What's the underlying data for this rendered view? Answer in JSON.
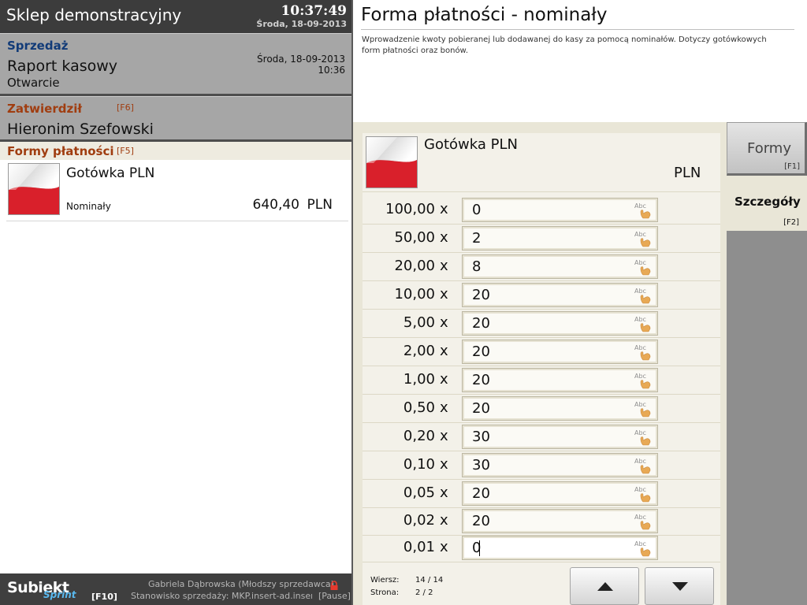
{
  "header": {
    "store_name": "Sklep demonstracyjny",
    "time": "10:37:49",
    "date": "Środa, 18-09-2013"
  },
  "sale": {
    "title": "Sprzedaż",
    "document": "Raport kasowy",
    "status": "Otwarcie",
    "date": "Środa, 18-09-2013",
    "time": "10:36"
  },
  "confirmed": {
    "title": "Zatwierdził",
    "key": "[F6]",
    "name": "Hieronim Szefowski"
  },
  "payment_forms": {
    "title": "Formy płatności",
    "key": "[F5]",
    "items": [
      {
        "name": "Gotówka PLN",
        "type": "Nominały",
        "amount": "640,40",
        "currency": "PLN"
      }
    ]
  },
  "footer": {
    "logo": "Subiekt",
    "logo_sub": "Sprint",
    "key": "[F10]",
    "user": "Gabriela Dąbrowska (Młodszy sprzedawca)",
    "station": "Stanowisko sprzedaży: MKP.insert-ad.insert....",
    "pause": "[Pause]"
  },
  "main": {
    "title": "Forma płatności - nominały",
    "description": "Wprowadzenie kwoty pobieranej lub dodawanej do kasy za pomocą nominałów. Dotyczy gotówkowych form płatności oraz bonów.",
    "card_name": "Gotówka PLN",
    "card_currency": "PLN",
    "multiply_sign": "x",
    "denominations": [
      {
        "value": "100,00",
        "count": "0"
      },
      {
        "value": "50,00",
        "count": "2"
      },
      {
        "value": "20,00",
        "count": "8"
      },
      {
        "value": "10,00",
        "count": "20"
      },
      {
        "value": "5,00",
        "count": "20"
      },
      {
        "value": "2,00",
        "count": "20"
      },
      {
        "value": "1,00",
        "count": "20"
      },
      {
        "value": "0,50",
        "count": "20"
      },
      {
        "value": "0,20",
        "count": "30"
      },
      {
        "value": "0,10",
        "count": "30"
      },
      {
        "value": "0,05",
        "count": "20"
      },
      {
        "value": "0,02",
        "count": "20"
      },
      {
        "value": "0,01",
        "count": "0"
      }
    ],
    "pager": {
      "row_label": "Wiersz:",
      "row_value": "14 / 14",
      "page_label": "Strona:",
      "page_value": "2 / 2"
    }
  },
  "tabs": {
    "forms": {
      "label": "Formy",
      "key": "[F1]"
    },
    "details": {
      "label": "Szczegóły",
      "key": "[F2]"
    }
  },
  "keyboard_icon_text": "Abc",
  "colors": {
    "header_bg": "#3c3c3c",
    "section_bg": "#a6a6a6",
    "sale_title": "#123b78",
    "accent_title": "#a03d10",
    "content_bg": "#e9e6d7",
    "flag_red": "#d9202b"
  }
}
